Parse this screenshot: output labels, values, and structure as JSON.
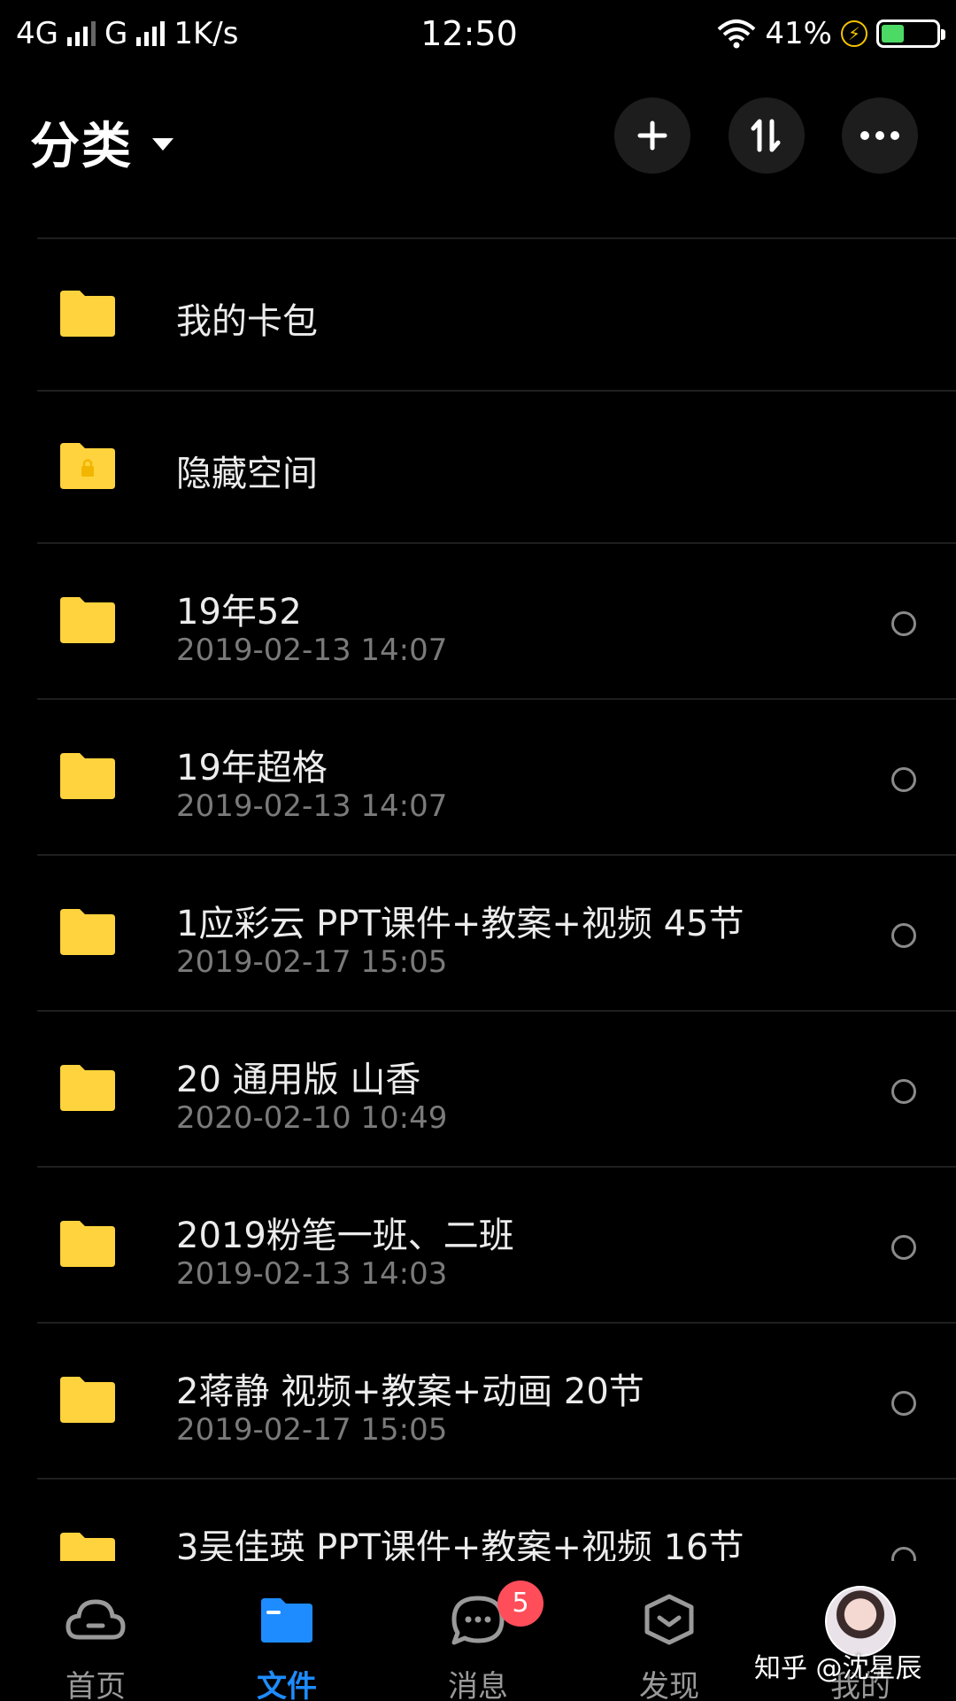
{
  "status_bar": {
    "network1": "4G",
    "network2": "G",
    "speed": "1K/s",
    "time": "12:50",
    "battery": "41%",
    "battery_level": 0.41,
    "charging_icon": "bolt-icon",
    "wifi_icon": "wifi-icon"
  },
  "header": {
    "title": "分类",
    "title_dropdown_icon": "caret-down-icon",
    "buttons": [
      "plus-icon",
      "sort-icon",
      "more-icon"
    ]
  },
  "list": {
    "items": [
      {
        "name": "我的卡包",
        "date": ""
      },
      {
        "name": "隐藏空间",
        "date": ""
      },
      {
        "name": "19年52",
        "date": "2019-02-13  14:07"
      },
      {
        "name": "19年超格",
        "date": "2019-02-13  14:07"
      },
      {
        "name": "1应彩云 PPT课件+教案+视频 45节",
        "date": "2019-02-17  15:05"
      },
      {
        "name": "20 通用版  山香",
        "date": "2020-02-10  10:49"
      },
      {
        "name": "2019粉笔一班、二班",
        "date": "2019-02-13  14:03"
      },
      {
        "name": "2蒋静 视频+教案+动画 20节",
        "date": "2019-02-17  15:05"
      },
      {
        "name": "3吴佳瑛 PPT课件+教案+视频 16节",
        "date": ""
      }
    ]
  },
  "tabbar": {
    "tabs": [
      {
        "label": "首页",
        "icon": "cloud-icon"
      },
      {
        "label": "文件",
        "icon": "folder-icon"
      },
      {
        "label": "消息",
        "icon": "chat-icon",
        "badge": "5"
      },
      {
        "label": "发现",
        "icon": "discover-icon"
      },
      {
        "label": "我的",
        "icon": "avatar"
      }
    ],
    "active": "文件"
  },
  "watermark": "知乎 @沈星辰",
  "colors": {
    "background": "#000000",
    "folder": "#ffd33d",
    "accent": "#1e8cff",
    "badge": "#ff4d5a"
  }
}
